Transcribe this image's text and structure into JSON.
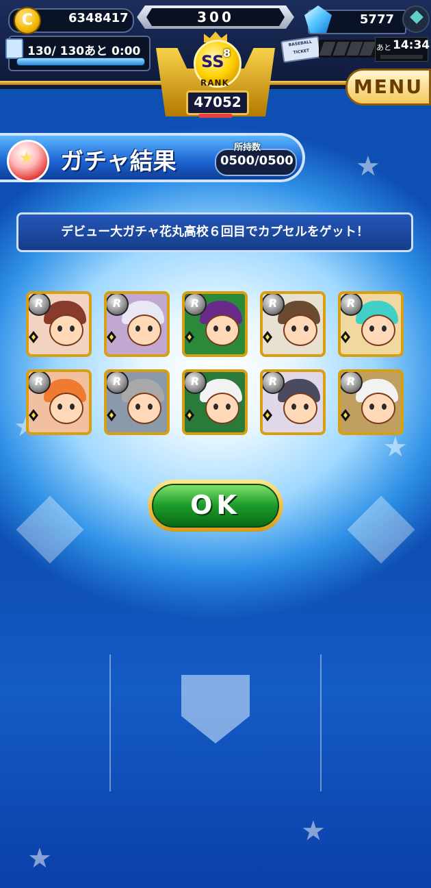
{
  "header": {
    "coins": "6348417",
    "stones": "300",
    "gems": "5777",
    "stamina": "130/ 130あと 0:00",
    "ticket_label": "BASEBALL TICKET",
    "ticket_time_label": "あと",
    "ticket_time": "14:34",
    "rank": {
      "grade": "SS",
      "sub": "8",
      "label": "RANK",
      "score": "47052"
    },
    "menu_label": "MENU"
  },
  "title": {
    "text": "ガチャ結果",
    "owned_label": "所持数",
    "owned_value": "0500/0500"
  },
  "message": "デビュー大ガチャ花丸高校６回目でカプセルをゲット！",
  "cards": [
    {
      "rarity": "R",
      "hair": "#8a3a2a",
      "bg": "#f2d2c0"
    },
    {
      "rarity": "R",
      "hair": "#e8e8f4",
      "bg": "#c0a8d0"
    },
    {
      "rarity": "R",
      "hair": "#6a2a8a",
      "bg": "#2a8a3a"
    },
    {
      "rarity": "R",
      "hair": "#6a4a30",
      "bg": "#e8e0d0"
    },
    {
      "rarity": "R",
      "hair": "#40d0c8",
      "bg": "#f0d8a0"
    },
    {
      "rarity": "R",
      "hair": "#f07a30",
      "bg": "#f0c0a0"
    },
    {
      "rarity": "R",
      "hair": "#a8a8a8",
      "bg": "#8a9aaa"
    },
    {
      "rarity": "R",
      "hair": "#f2f2f2",
      "bg": "#2a7a3a"
    },
    {
      "rarity": "R",
      "hair": "#4a4a60",
      "bg": "#e0d8e8"
    },
    {
      "rarity": "R",
      "hair": "#f2f2f2",
      "bg": "#c0a060"
    }
  ],
  "ok_label": "OK"
}
